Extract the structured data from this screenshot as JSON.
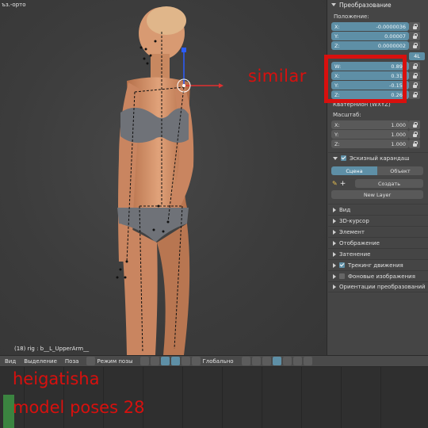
{
  "viewport": {
    "view_label": "ъз.-орто",
    "status_line": "(18) rig : b__L_UpperArm__"
  },
  "properties": {
    "transform_header": "Преобразование",
    "location_label": "Положение:",
    "location": [
      {
        "axis": "X:",
        "value": "-0.0000036"
      },
      {
        "axis": "Y:",
        "value": "0.00007"
      },
      {
        "axis": "Z:",
        "value": "0.0000002"
      }
    ],
    "mode_button": "4L",
    "rotation": [
      {
        "axis": "W:",
        "value": "0.896"
      },
      {
        "axis": "X:",
        "value": "0.319"
      },
      {
        "axis": "Y:",
        "value": "-0.157"
      },
      {
        "axis": "Z:",
        "value": "0.265"
      }
    ],
    "rotation_mode": "Кватернион (WXYZ)",
    "scale_label": "Масштаб:",
    "scale": [
      {
        "axis": "X:",
        "value": "1.000"
      },
      {
        "axis": "Y:",
        "value": "1.000"
      },
      {
        "axis": "Z:",
        "value": "1.000"
      }
    ],
    "grease_pencil_header": "Эскизный карандаш",
    "tab_scene": "Сцена",
    "tab_object": "Объект",
    "create_label": "Создать",
    "new_layer_label": "New Layer",
    "sections": [
      "Вид",
      "3D-курсор",
      "Элемент",
      "Отображение",
      "Затенение"
    ],
    "motion_tracking": "Трекинг движения",
    "background_images": "Фоновые изображения",
    "transform_orientations": "Ориентации преобразований"
  },
  "toolbar": {
    "view": "Вид",
    "select": "Выделение",
    "pose": "Поза",
    "mode": "Режим позы",
    "orientation": "Глобально"
  },
  "overlays": {
    "similar": "similar",
    "name": "heigatisha",
    "poses": "model poses 28",
    "accent_color": "#d8100e"
  },
  "colors": {
    "field_blue": "#5e8fa6",
    "panel_bg": "#454545",
    "viewport_bg": "#3c3c3c"
  }
}
